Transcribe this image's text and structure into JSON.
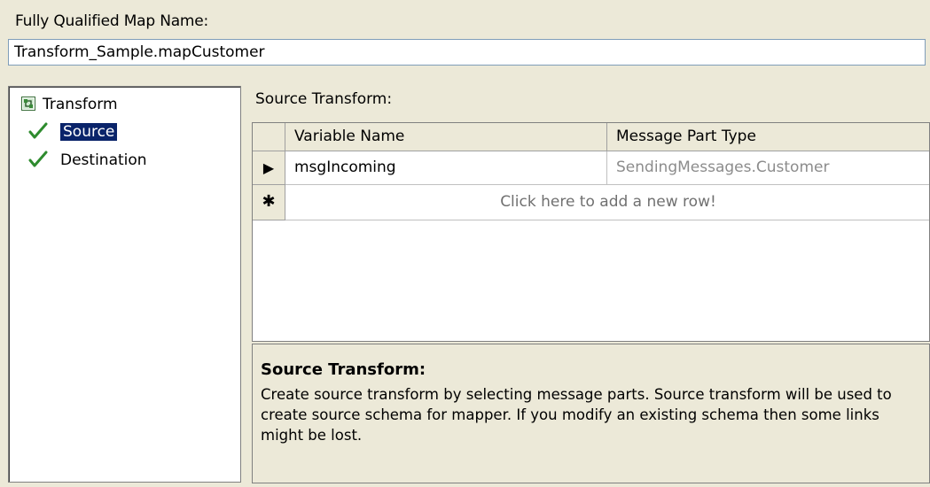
{
  "map_name": {
    "label": "Fully Qualified Map Name:",
    "value": "Transform_Sample.mapCustomer"
  },
  "tree": {
    "root": "Transform",
    "children": [
      {
        "label": "Source",
        "selected": true,
        "icon": "checkmark-icon"
      },
      {
        "label": "Destination",
        "selected": false,
        "icon": "checkmark-icon"
      }
    ]
  },
  "source_transform": {
    "label": "Source Transform:",
    "columns": [
      "Variable Name",
      "Message Part Type"
    ],
    "rows": [
      {
        "variable_name": "msgIncoming",
        "message_part_type": "SendingMessages.Customer"
      }
    ],
    "add_row_text": "Click here to add a new row!",
    "row_indicators": {
      "current": "▶",
      "new": "✱"
    }
  },
  "help": {
    "title": "Source Transform:",
    "text": "Create source transform by selecting message parts. Source transform will be used to create source schema for mapper. If you modify an existing schema then some links might be lost."
  },
  "colors": {
    "background": "#ece9d8",
    "selection": "#0a246a",
    "check": "#2e8b2e"
  }
}
